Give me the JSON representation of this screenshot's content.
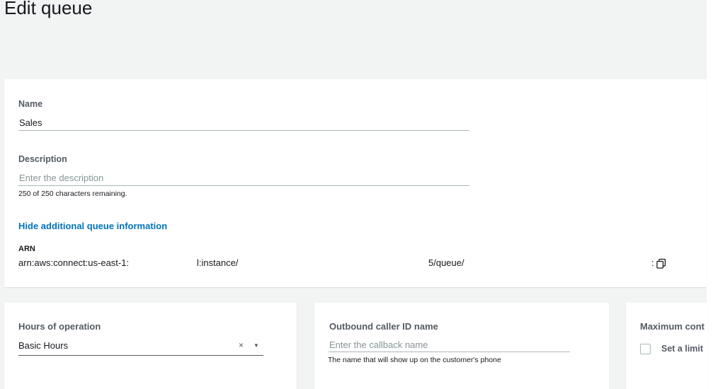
{
  "page": {
    "title": "Edit queue"
  },
  "form": {
    "name": {
      "label": "Name",
      "value": "Sales"
    },
    "description": {
      "label": "Description",
      "placeholder": "Enter the description",
      "hint": "250 of 250 characters remaining."
    },
    "toggle_link": "Hide additional queue information",
    "arn": {
      "label": "ARN",
      "segments": [
        "arn:aws:connect:us-east-1:",
        "l:instance/",
        "5/queue/",
        ":"
      ]
    }
  },
  "hours_of_operation": {
    "label": "Hours of operation",
    "value": "Basic Hours",
    "clear_glyph": "×",
    "caret_glyph": "▼"
  },
  "outbound_caller": {
    "label": "Outbound caller ID name",
    "placeholder": "Enter the callback name",
    "hint": "The name that will show up on the customer's phone"
  },
  "max_contacts": {
    "label": "Maximum cont",
    "checkbox_label": "Set a limit"
  },
  "icons": {
    "copy": "copy-icon"
  },
  "colors": {
    "link": "#0073bb",
    "background": "#f2f3f3",
    "panel": "#ffffff"
  }
}
